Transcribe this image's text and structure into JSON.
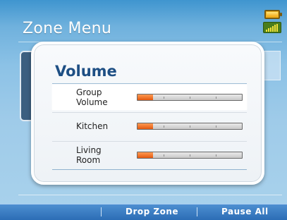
{
  "header": {
    "title": "Zone Menu"
  },
  "status": {
    "battery_icon": "battery-icon",
    "signal_icon": "signal-strength-icon"
  },
  "dialog": {
    "title": "Volume",
    "rows": [
      {
        "label": "Group Volume",
        "level": 0.15,
        "selected": true
      },
      {
        "label": "Kitchen",
        "level": 0.15,
        "selected": false
      },
      {
        "label": "Living Room",
        "level": 0.15,
        "selected": false
      }
    ]
  },
  "softkeys": {
    "left": "",
    "middle": "Drop Zone",
    "right": "Pause All"
  },
  "colors": {
    "accent": "#e45a10",
    "title": "#1e4f84",
    "softbar": "#2c6db5"
  }
}
